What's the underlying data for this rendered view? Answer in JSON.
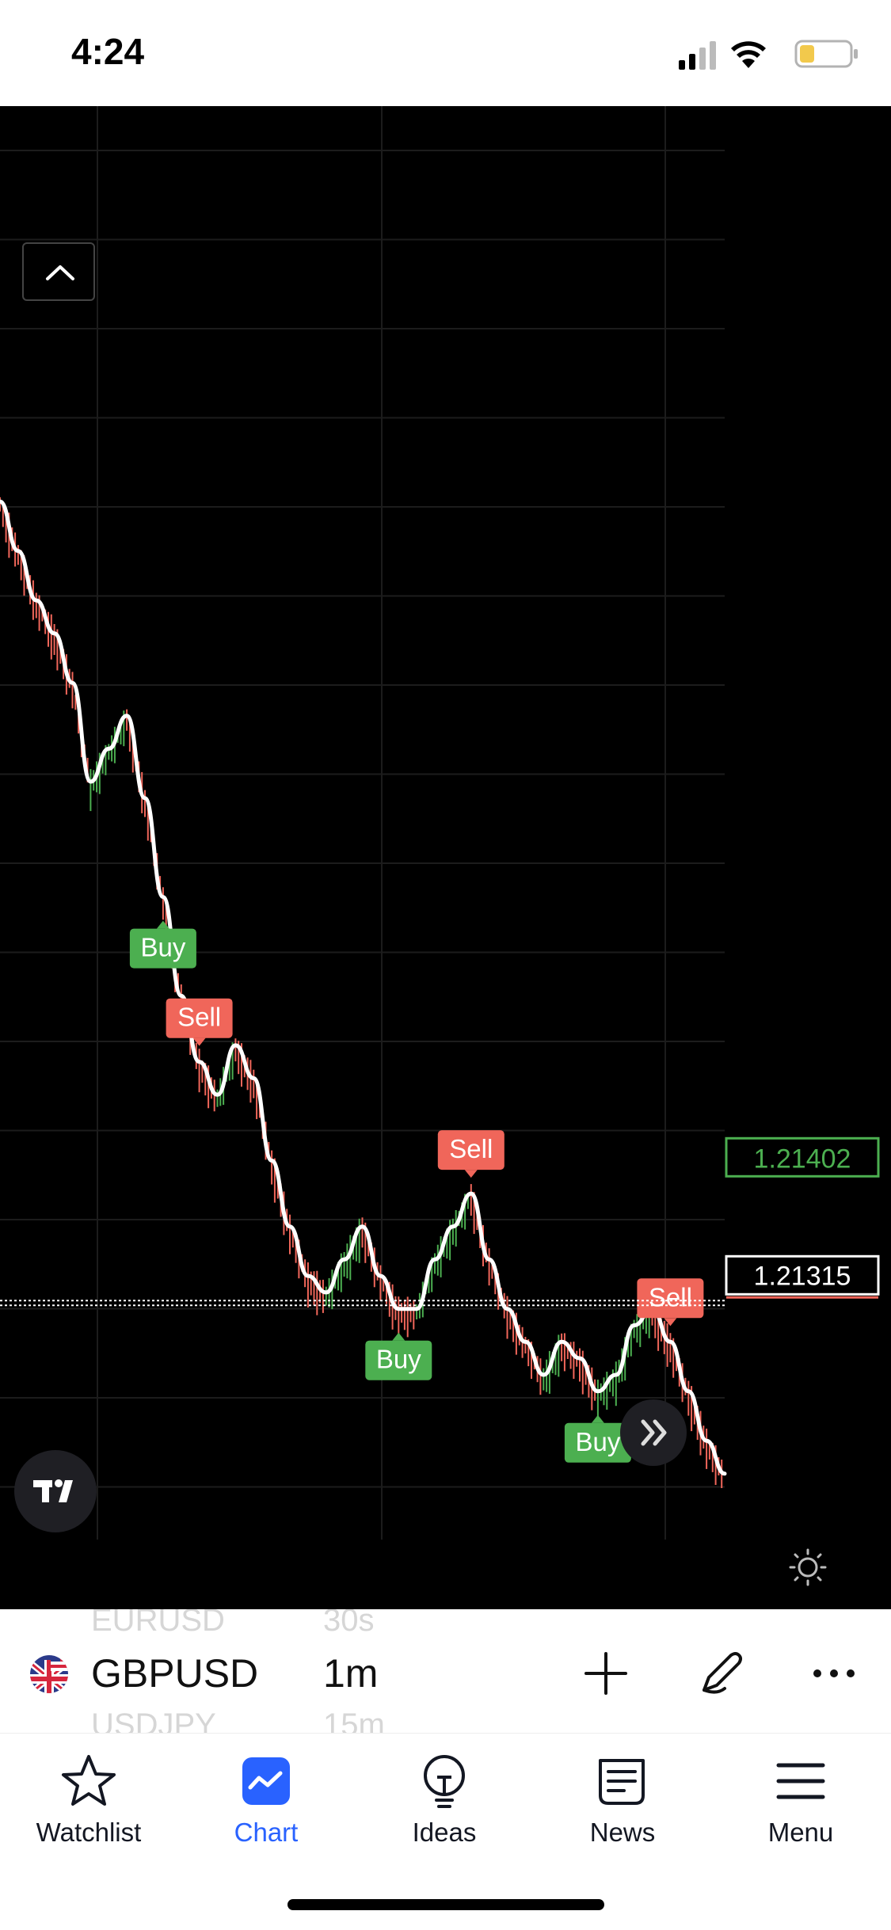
{
  "status_bar": {
    "time": "4:24",
    "icons": [
      "cellular-signal-icon",
      "wifi-icon",
      "battery-low-icon"
    ]
  },
  "chart": {
    "symbol": "GBPUSD",
    "interval": "1m",
    "price_labels": {
      "upper": "1.21402",
      "current": "1.21315",
      "upper_color": "#4caf50",
      "current_color": "#ffffff"
    },
    "signals": [
      {
        "label": "Sell",
        "type": "sell"
      },
      {
        "label": "Buy",
        "type": "buy"
      },
      {
        "label": "Sell",
        "type": "sell"
      },
      {
        "label": "Buy",
        "type": "buy"
      },
      {
        "label": "Sell",
        "type": "sell"
      },
      {
        "label": "Buy",
        "type": "buy"
      }
    ],
    "colors": {
      "background": "#000000",
      "bull": "#4caf50",
      "bear": "#f0665a",
      "line": "#ffffff",
      "sell_badge": "#f0665a",
      "buy_badge": "#4caf50"
    }
  },
  "chart_data": {
    "type": "line",
    "title": "",
    "xlabel": "",
    "ylabel": "",
    "series": [
      {
        "values": [
          1.218,
          1.2177,
          1.2174,
          1.2172,
          1.2169,
          1.2163,
          1.2165,
          1.2167,
          1.2162,
          1.2156,
          1.215,
          1.2146,
          1.2144,
          1.2147,
          1.2145,
          1.214,
          1.2136,
          1.2133,
          1.2132,
          1.2134,
          1.2136,
          1.2133,
          1.2131,
          1.2131,
          1.2134,
          1.2136,
          1.2138,
          1.2134,
          1.2131,
          1.2129,
          1.2127,
          1.2129,
          1.2128,
          1.2126,
          1.2127,
          1.213,
          1.2131,
          1.2129,
          1.2126,
          1.2123,
          1.2121
        ]
      }
    ],
    "ylim": [
      1.2117,
      1.2204
    ],
    "last_price": 1.21315,
    "marked_price": 1.21402,
    "grid": true,
    "legend": "none"
  },
  "ticker_bar": {
    "prev_symbol": "EURUSD",
    "prev_interval": "30s",
    "next_symbol": "USDJPY",
    "next_interval": "15m",
    "flag_icon": "uk-us-flag-icon",
    "add_icon": "plus-icon",
    "draw_icon": "pen-icon",
    "more_icon": "more-dots-icon"
  },
  "tabs": [
    {
      "label": "Watchlist",
      "icon": "star-icon",
      "active": false
    },
    {
      "label": "Chart",
      "icon": "chart-icon",
      "active": true
    },
    {
      "label": "Ideas",
      "icon": "lightbulb-icon",
      "active": false
    },
    {
      "label": "News",
      "icon": "newspaper-icon",
      "active": false
    },
    {
      "label": "Menu",
      "icon": "hamburger-icon",
      "active": false
    }
  ]
}
